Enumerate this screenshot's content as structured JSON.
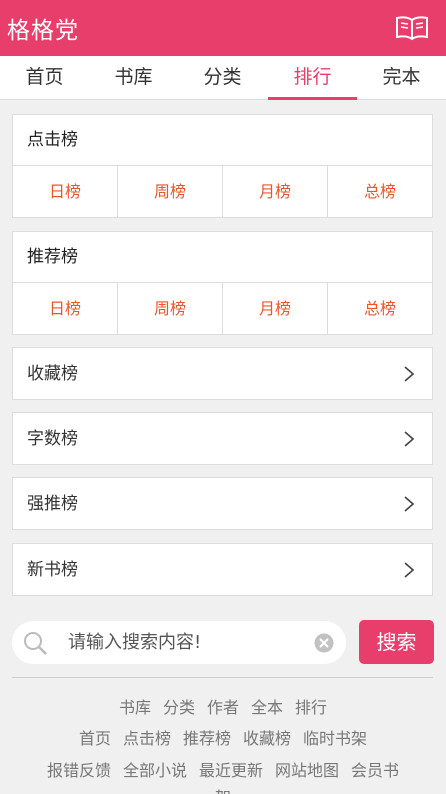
{
  "header": {
    "site_name": "格格党",
    "book_icon": "open-book-icon"
  },
  "nav": {
    "tabs": [
      {
        "label": "首页",
        "active": false
      },
      {
        "label": "书库",
        "active": false
      },
      {
        "label": "分类",
        "active": false
      },
      {
        "label": "排行",
        "active": true
      },
      {
        "label": "完本",
        "active": false
      }
    ]
  },
  "rankings": {
    "click": {
      "title": "点击榜",
      "periods": [
        "日榜",
        "周榜",
        "月榜",
        "总榜"
      ]
    },
    "recommend": {
      "title": "推荐榜",
      "periods": [
        "日榜",
        "周榜",
        "月榜",
        "总榜"
      ]
    },
    "lists": [
      {
        "label": "收藏榜"
      },
      {
        "label": "字数榜"
      },
      {
        "label": "强推榜"
      },
      {
        "label": "新书榜"
      }
    ]
  },
  "search": {
    "placeholder": "请输入搜索内容!",
    "button": "搜索"
  },
  "footer": {
    "line1": [
      "书库",
      "分类",
      "作者",
      "全本",
      "排行"
    ],
    "line2": [
      "首页",
      "点击榜",
      "推荐榜",
      "收藏榜",
      "临时书架"
    ],
    "line3": [
      "报错反馈",
      "全部小说",
      "最近更新",
      "网站地图",
      "会员书"
    ],
    "line4": [
      "架"
    ]
  },
  "colors": {
    "accent": "#e83e6c",
    "period_text": "#e8572a",
    "background": "#f0f0f0"
  }
}
